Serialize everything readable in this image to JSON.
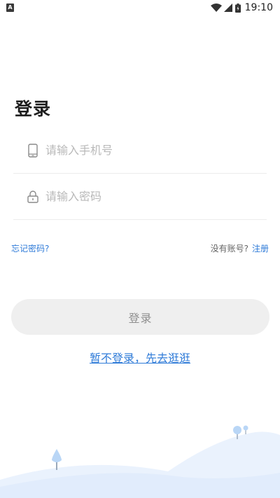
{
  "status_bar": {
    "notification_icon": "A",
    "wifi_icon": "wifi-icon",
    "signal_icon": "signal-icon",
    "battery_icon": "battery-icon",
    "time": "19:10"
  },
  "page": {
    "title": "登录"
  },
  "phone_field": {
    "icon": "phone-icon",
    "placeholder": "请输入手机号",
    "value": ""
  },
  "password_field": {
    "icon": "lock-icon",
    "placeholder": "请输入密码",
    "value": ""
  },
  "links": {
    "forgot_password": "忘记密码?",
    "no_account": "没有账号?",
    "register": "注册"
  },
  "login_button": {
    "label": "登录"
  },
  "skip_login": {
    "label": "暂不登录，先去逛逛"
  },
  "colors": {
    "link": "#2f7bd8",
    "button_bg": "#efefef",
    "button_text": "#8f8f8f",
    "hill_light": "#eaf2fd",
    "tree": "#b9d6f6"
  }
}
